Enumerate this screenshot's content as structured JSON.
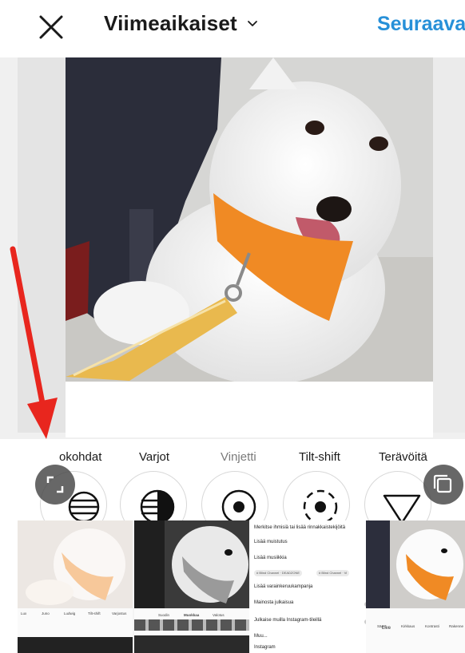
{
  "header": {
    "title": "Viimeaikaiset",
    "next_label": "Seuraava"
  },
  "icons": {
    "close": "close-icon",
    "dropdown": "chevron-down-icon",
    "expand": "expand-icon",
    "multi_select": "multi-select-icon"
  },
  "tools": [
    {
      "label": "Kohokohdat",
      "shown_label": "okohdat",
      "icon": "highlights-icon"
    },
    {
      "label": "Varjot",
      "icon": "shadows-icon"
    },
    {
      "label": "Vinjetti",
      "icon": "vignette-icon"
    },
    {
      "label": "Tilt-shift",
      "icon": "tilt-shift-icon"
    },
    {
      "label": "Terävöitä",
      "icon": "sharpen-icon"
    }
  ],
  "thumbnail_menu": {
    "items": [
      "Merkitse ihmisiä tai lisää rinnakkaistekijöitä",
      "Lisää muistutus",
      "Lisää musiikkia",
      "Lisää varainkeruukampanja",
      "Mainosta julkaisua",
      "Julkaise muilla Instagram-tileillä",
      "Muu...",
      "Instagram"
    ],
    "chips": [
      "# Blind Channel · DEADZONE",
      "# Blind Channel · Vi"
    ]
  },
  "mini_tabs_left": [
    "Lux",
    "Juno",
    "Ludwig",
    "Tilt-shift",
    "Varjostus"
  ],
  "mini_tabs_mid": [
    "Suodin",
    "Muokkaa",
    "Valotus"
  ],
  "mini_tabs_right": [
    "Säätö",
    "Kirkkaus",
    "Kontrasti",
    "Rakenne"
  ],
  "mini_live": "Live",
  "colors": {
    "accent": "#2790d8",
    "annotation": "#e8261e",
    "scarf": "#f08a24"
  }
}
